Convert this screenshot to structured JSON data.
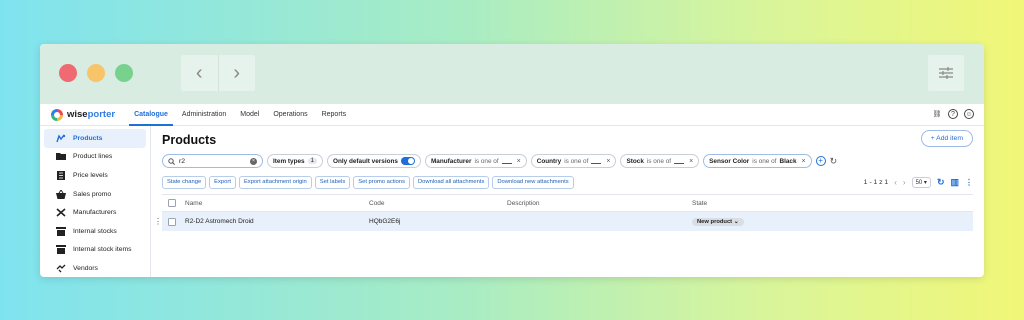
{
  "window": {
    "controls": [
      "close",
      "minimize",
      "maximize"
    ]
  },
  "brand": {
    "prefix": "wise",
    "suffix": "porter"
  },
  "topnav": {
    "tabs": [
      {
        "label": "Catalogue",
        "active": true
      },
      {
        "label": "Administration",
        "active": false
      },
      {
        "label": "Model",
        "active": false
      },
      {
        "label": "Operations",
        "active": false
      },
      {
        "label": "Reports",
        "active": false
      }
    ]
  },
  "sidebar": {
    "items": [
      {
        "label": "Products",
        "icon": "products-icon",
        "active": true
      },
      {
        "label": "Product lines",
        "icon": "folder-icon",
        "active": false
      },
      {
        "label": "Price levels",
        "icon": "price-list-icon",
        "active": false
      },
      {
        "label": "Sales promo",
        "icon": "basket-icon",
        "active": false
      },
      {
        "label": "Manufacturers",
        "icon": "tools-icon",
        "active": false
      },
      {
        "label": "Internal stocks",
        "icon": "store-icon",
        "active": false
      },
      {
        "label": "Internal stock items",
        "icon": "store-items-icon",
        "active": false
      },
      {
        "label": "Vendors",
        "icon": "handshake-icon",
        "active": false
      }
    ]
  },
  "main": {
    "title": "Products",
    "add_label": "+ Add item",
    "search": {
      "value": "r2"
    },
    "filters": {
      "item_types": {
        "label": "Item types",
        "count": "1"
      },
      "only_default": {
        "label": "Only default versions",
        "on": true
      },
      "manufacturer": {
        "label": "Manufacturer",
        "op": "is one of"
      },
      "country": {
        "label": "Country",
        "op": "is one of"
      },
      "stock": {
        "label": "Stock",
        "op": "is one of"
      },
      "sensor_color": {
        "label": "Sensor Color",
        "op": "is one of",
        "value": "Black"
      }
    },
    "actions": [
      "State change",
      "Export",
      "Export attachment origin",
      "Set labels",
      "Set promo actions",
      "Download all attachments",
      "Download new attachments"
    ],
    "pager": {
      "range": "1 - 1 z 1",
      "page_size": "50"
    },
    "table": {
      "columns": [
        "Name",
        "Code",
        "Description",
        "State"
      ],
      "rows": [
        {
          "name": "R2-D2 Astromech Droid",
          "code": "HQbG2E6j",
          "description": "",
          "state": "New product"
        }
      ]
    }
  },
  "colors": {
    "accent": "#1f6fd8",
    "selected_row": "#e8f0fb"
  }
}
